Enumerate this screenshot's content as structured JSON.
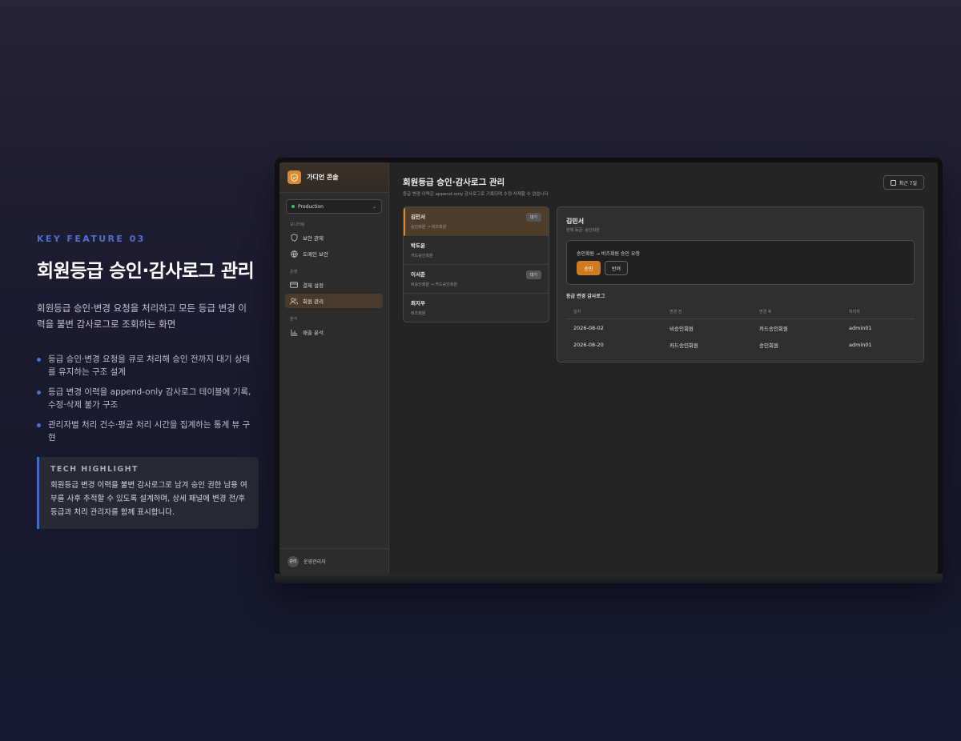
{
  "left": {
    "kicker": "KEY FEATURE 03",
    "headline": "회원등급 승인·감사로그 관리",
    "desc": "회원등급 승인·변경 요청을 처리하고 모든 등급 변경 이력을 불변 감사로그로 조회하는 화면",
    "bullets": [
      "등급 승인·변경 요청을 큐로 처리해 승인 전까지 대기 상태를 유지하는 구조 설계",
      "등급 변경 이력을 append-only 감사로그 테이블에 기록, 수정·삭제 불가 구조",
      "관리자별 처리 건수·평균 처리 시간을 집계하는 통계 뷰 구현"
    ],
    "highlight_title": "TECH HIGHLIGHT",
    "highlight_body": "회원등급 변경 이력을 불변 감사로그로 남겨 승인 권한 남용 여부를 사후 추적할 수 있도록 설계하며, 상세 패널에 변경 전/후 등급과 처리 관리자를 함께 표시합니다."
  },
  "app": {
    "brand": "가디언 콘솔",
    "environment": "Production",
    "sections": {
      "monitoring": "모니터링",
      "operations": "운영",
      "analytics": "분석"
    },
    "nav": {
      "security": "보안 관제",
      "domain": "도메인 보안",
      "payment": "결제 설정",
      "members": "회원 관리",
      "sales": "매출 분석"
    },
    "admin_avatar": "관리",
    "admin_name": "운영관리자",
    "page_title": "회원등급 승인·감사로그 관리",
    "page_subtitle": "등급 변경 이력은 append-only 감사로그로 기록되며 수정·삭제할 수 없습니다",
    "range_button": "최근 7일",
    "members": [
      {
        "name": "김민서",
        "sub": "승인회원 → 비즈회원",
        "badge": "대기"
      },
      {
        "name": "박도윤",
        "sub": "카드승인회원",
        "badge": ""
      },
      {
        "name": "이서준",
        "sub": "비승인회원 → 카드승인회원",
        "badge": "대기"
      },
      {
        "name": "최지우",
        "sub": "비즈회원",
        "badge": ""
      }
    ],
    "detail": {
      "name": "김민서",
      "current": "현재 등급: 승인회원",
      "request": "승인회원 → 비즈회원 승인 요청",
      "approve": "승인",
      "reject": "반려",
      "log_title": "등급 변경 감사로그",
      "columns": [
        "일자",
        "변경 전",
        "변경 후",
        "처리자"
      ],
      "rows": [
        [
          "2026-08-02",
          "비승인회원",
          "카드승인회원",
          "admin01"
        ],
        [
          "2026-08-20",
          "카드승인회원",
          "승인회원",
          "admin01"
        ]
      ]
    },
    "colors": {
      "accent": "#d07a22",
      "kicker": "#4f6fc9",
      "status_ok": "#3bbf6a"
    }
  }
}
